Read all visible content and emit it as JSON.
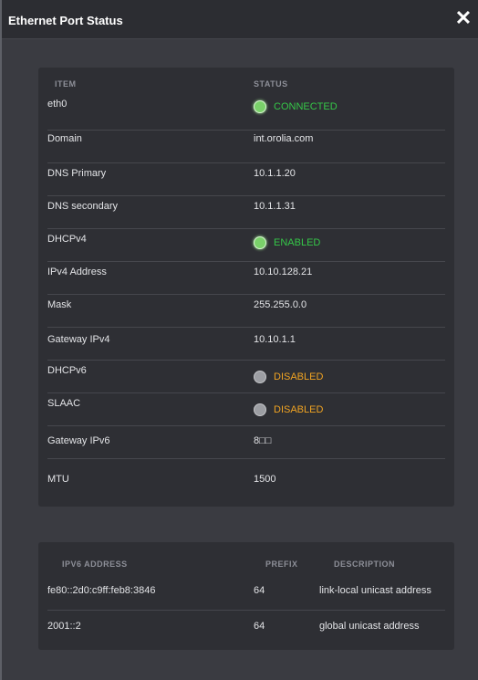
{
  "dialog": {
    "title": "Ethernet Port Status",
    "close_glyph": "✕"
  },
  "status_table": {
    "headers": {
      "item": "ITEM",
      "status": "STATUS"
    },
    "rows": [
      {
        "item": "eth0",
        "status": "CONNECTED",
        "indicator": "green"
      },
      {
        "item": "Domain",
        "status": "int.orolia.com"
      },
      {
        "item": "DNS Primary",
        "status": "10.1.1.20"
      },
      {
        "item": "DNS secondary",
        "status": "10.1.1.31"
      },
      {
        "item": "DHCPv4",
        "status": "ENABLED",
        "indicator": "green"
      },
      {
        "item": "IPv4 Address",
        "status": "10.10.128.21"
      },
      {
        "item": "Mask",
        "status": "255.255.0.0"
      },
      {
        "item": "Gateway IPv4",
        "status": "10.10.1.1"
      },
      {
        "item": "DHCPv6",
        "status": "DISABLED",
        "indicator": "gray"
      },
      {
        "item": "SLAAC",
        "status": "DISABLED",
        "indicator": "gray"
      },
      {
        "item": "Gateway IPv6",
        "status": "8□□"
      },
      {
        "item": "MTU",
        "status": "1500"
      }
    ]
  },
  "ipv6_table": {
    "headers": {
      "address": "IPV6 ADDRESS",
      "prefix": "PREFIX",
      "description": "DESCRIPTION"
    },
    "rows": [
      {
        "address": "fe80::2d0:c9ff:feb8:3846",
        "prefix": "64",
        "description": "link-local unicast address"
      },
      {
        "address": "2001::2",
        "prefix": "64",
        "description": "global unicast address"
      }
    ]
  },
  "colors": {
    "connected": "#35c748",
    "disabled": "#f0a322",
    "background": "#3a3b41",
    "panel": "#2e2f34"
  }
}
